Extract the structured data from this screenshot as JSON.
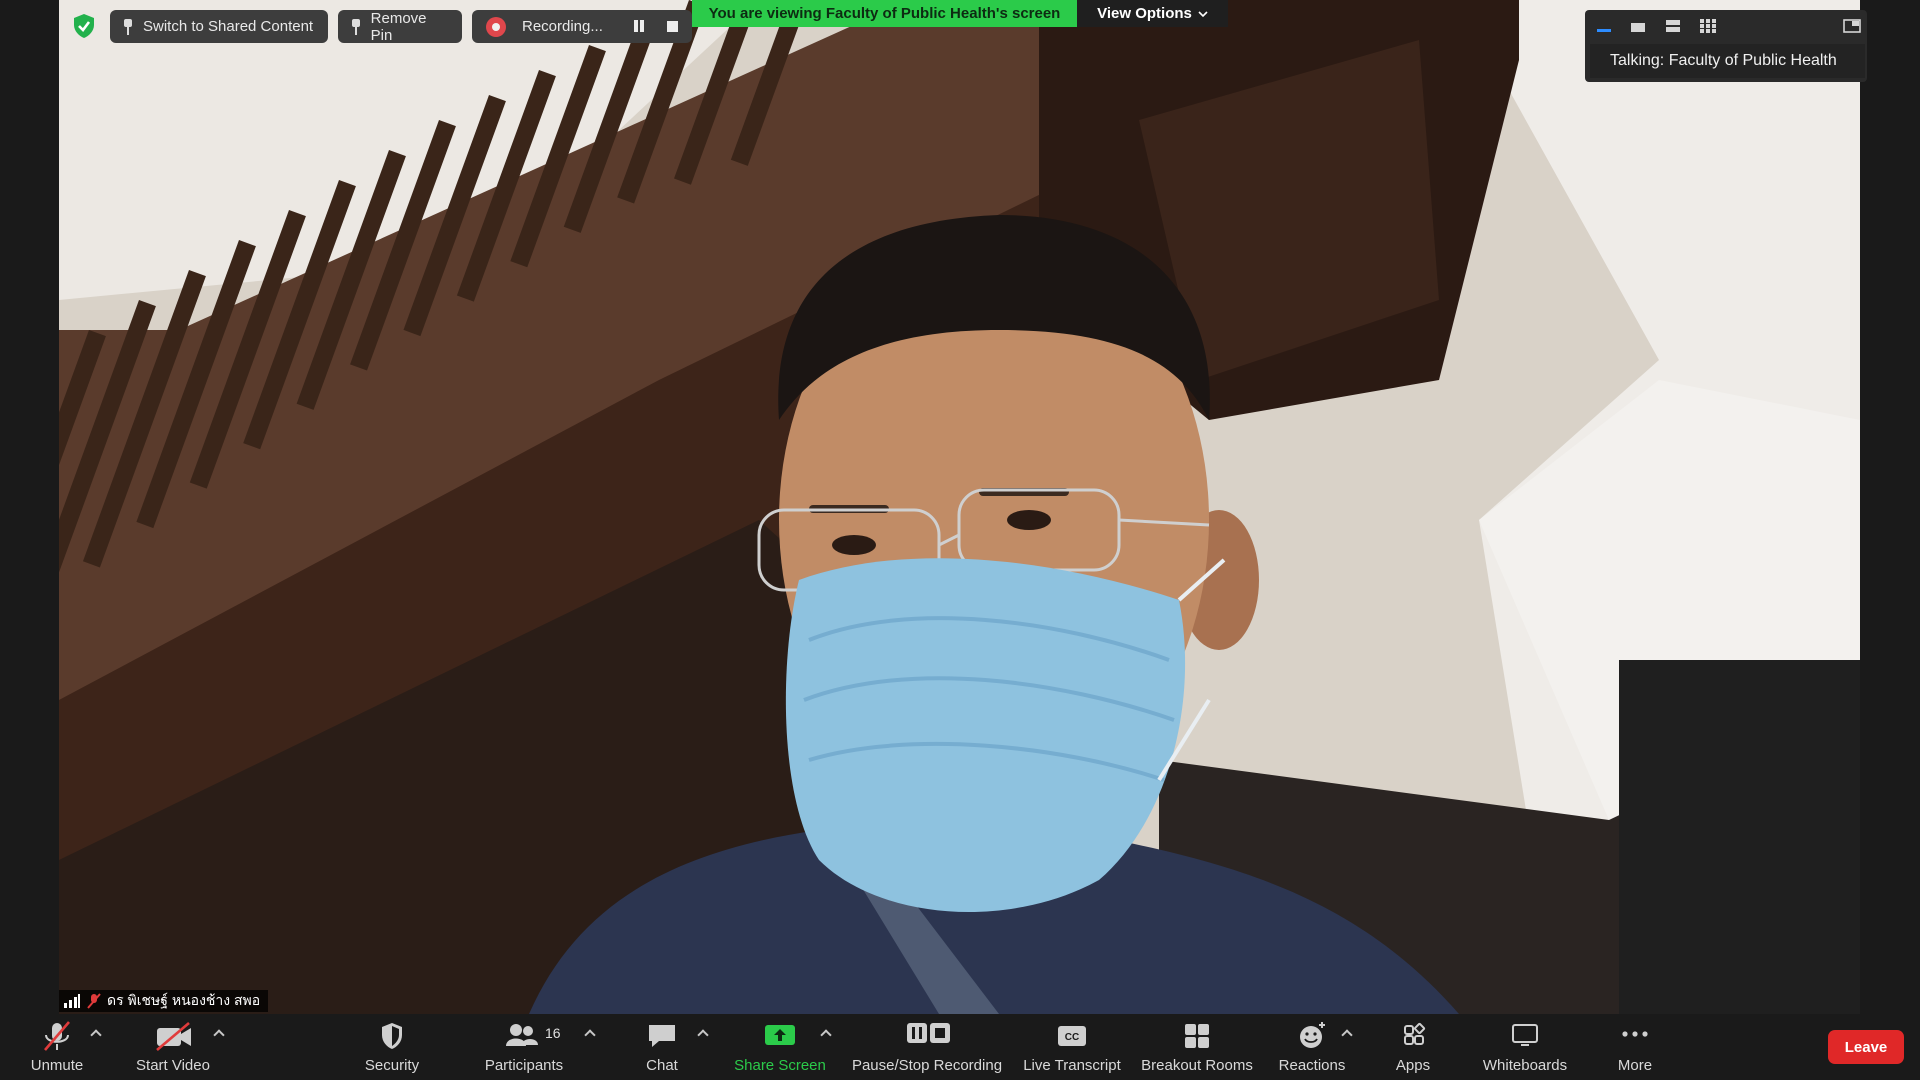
{
  "top_bar": {
    "switch_shared_label": "Switch to Shared Content",
    "remove_pin_label": "Remove Pin",
    "recording_label": "Recording...",
    "viewing_banner": "You are viewing Faculty of Public Health's screen",
    "view_options_label": "View Options"
  },
  "talking_indicator": "Talking: Faculty of Public Health",
  "participant_name": "ดร พิเชษฐ์ หนองช้าง สพอ",
  "toolbar": {
    "unmute": "Unmute",
    "start_video": "Start Video",
    "security": "Security",
    "participants": "Participants",
    "participants_count": "16",
    "chat": "Chat",
    "share_screen": "Share Screen",
    "pause_stop_recording": "Pause/Stop Recording",
    "live_transcript": "Live Transcript",
    "breakout_rooms": "Breakout Rooms",
    "reactions": "Reactions",
    "apps": "Apps",
    "whiteboards": "Whiteboards",
    "more": "More",
    "leave": "Leave",
    "cc_text": "CC"
  },
  "colors": {
    "banner_green": "#2bcb4a",
    "leave_red": "#e02828",
    "share_green": "#2bcb4a",
    "recording_red": "#e0474c",
    "muted_red": "#e03b3b"
  }
}
